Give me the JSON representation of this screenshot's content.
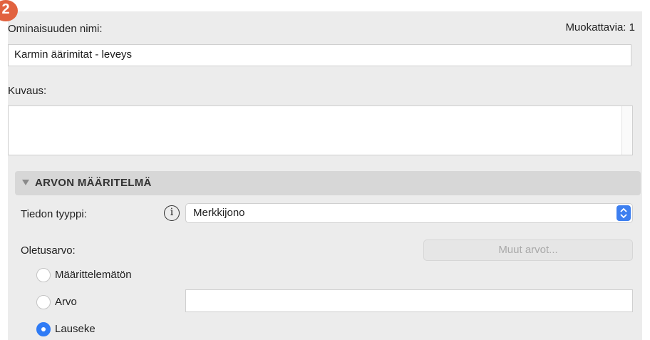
{
  "step_badge": "2",
  "property_name": {
    "label": "Ominaisuuden nimi:",
    "editable_count": "Muokattavia: 1",
    "value": "Karmin äärimitat - leveys"
  },
  "description": {
    "label": "Kuvaus:",
    "value": ""
  },
  "value_definition": {
    "section_title": "ARVON MÄÄRITELMÄ",
    "data_type_label": "Tiedon tyyppi:",
    "info_icon_glyph": "i",
    "data_type_value": "Merkkijono",
    "default_label": "Oletusarvo:",
    "other_values_button": "Muut arvot...",
    "options": [
      {
        "label": "Määrittelemätön",
        "checked": false
      },
      {
        "label": "Arvo",
        "checked": false
      },
      {
        "label": "Lauseke",
        "checked": true
      }
    ],
    "value_field": ""
  },
  "colors": {
    "accent": "#2f7bf5",
    "badge": "#e1623f",
    "panel": "#ececec"
  }
}
